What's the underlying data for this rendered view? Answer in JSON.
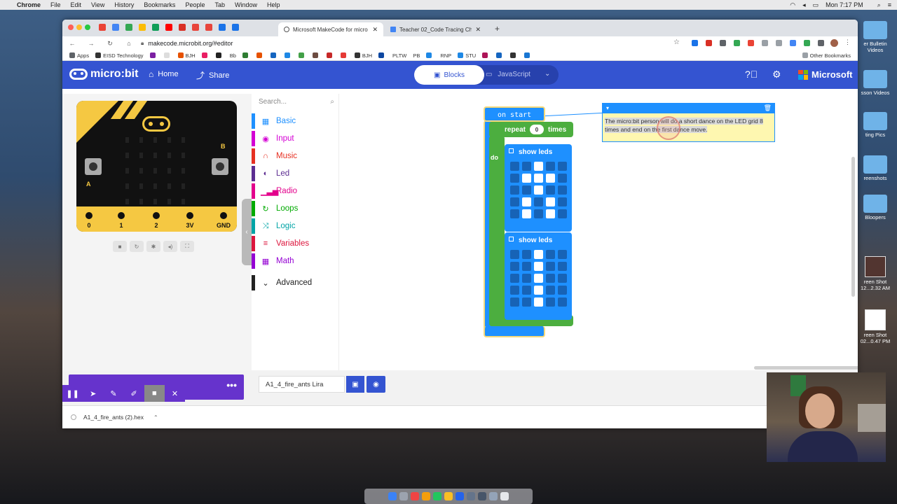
{
  "menubar": {
    "app": "Chrome",
    "items": [
      "File",
      "Edit",
      "View",
      "History",
      "Bookmarks",
      "People",
      "Tab",
      "Window",
      "Help"
    ],
    "clock": "Mon 7:17 PM"
  },
  "desktop_icons": [
    "er Bulletin Videos",
    "sson Videos",
    "ting Pics",
    "reenshots",
    "Bloopers",
    "reen Shot 12...2.32 AM",
    "reen Shot 02...0.47 PM"
  ],
  "browser": {
    "tabs": [
      {
        "title": "Microsoft MakeCode for micro"
      },
      {
        "title": "Teacher 02_Code Tracing Cha"
      }
    ],
    "url": "makecode.microbit.org/#editor",
    "bookmarks": [
      "Apps",
      "EISD Technology",
      "BJH",
      "Bb",
      "BJH",
      "PLTW",
      "PB",
      "RNP",
      "STU"
    ],
    "other_bookmarks": "Other Bookmarks"
  },
  "header": {
    "logo": "micro:bit",
    "home": "Home",
    "share": "Share",
    "blocks": "Blocks",
    "javascript": "JavaScript",
    "microsoft": "Microsoft"
  },
  "simulator": {
    "pins": [
      "0",
      "1",
      "2",
      "3V",
      "GND"
    ],
    "button_a": "A",
    "button_b": "B"
  },
  "toolbox": {
    "search_placeholder": "Search...",
    "categories": [
      {
        "label": "Basic",
        "color": "#1e90ff"
      },
      {
        "label": "Input",
        "color": "#d400d4"
      },
      {
        "label": "Music",
        "color": "#e63022"
      },
      {
        "label": "Led",
        "color": "#5c2d91"
      },
      {
        "label": "Radio",
        "color": "#e3008c"
      },
      {
        "label": "Loops",
        "color": "#00aa00"
      },
      {
        "label": "Logic",
        "color": "#00a4a6"
      },
      {
        "label": "Variables",
        "color": "#dc143c"
      },
      {
        "label": "Math",
        "color": "#9400d3"
      }
    ],
    "advanced": "Advanced"
  },
  "workspace": {
    "on_start": "on start",
    "repeat": "repeat",
    "repeat_count": "0",
    "times": "times",
    "do": "do",
    "show_leds_1": "show leds",
    "show_leds_2": "show leds",
    "leds_1": [
      0,
      0,
      1,
      0,
      0,
      0,
      1,
      1,
      1,
      0,
      0,
      0,
      1,
      0,
      0,
      0,
      1,
      0,
      1,
      0,
      0,
      1,
      0,
      1,
      0
    ],
    "leds_2": [
      0,
      0,
      1,
      0,
      0,
      0,
      0,
      1,
      0,
      0,
      0,
      0,
      1,
      0,
      0,
      0,
      0,
      1,
      0,
      0,
      0,
      0,
      1,
      0,
      0
    ],
    "comment": "The micro:bit person will do a short dance on the LED grid 8 times and end on the first dance move."
  },
  "footer": {
    "project_name": "A1_4_fire_ants Lira"
  },
  "downloads": {
    "file": "A1_4_fire_ants (2).hex"
  }
}
